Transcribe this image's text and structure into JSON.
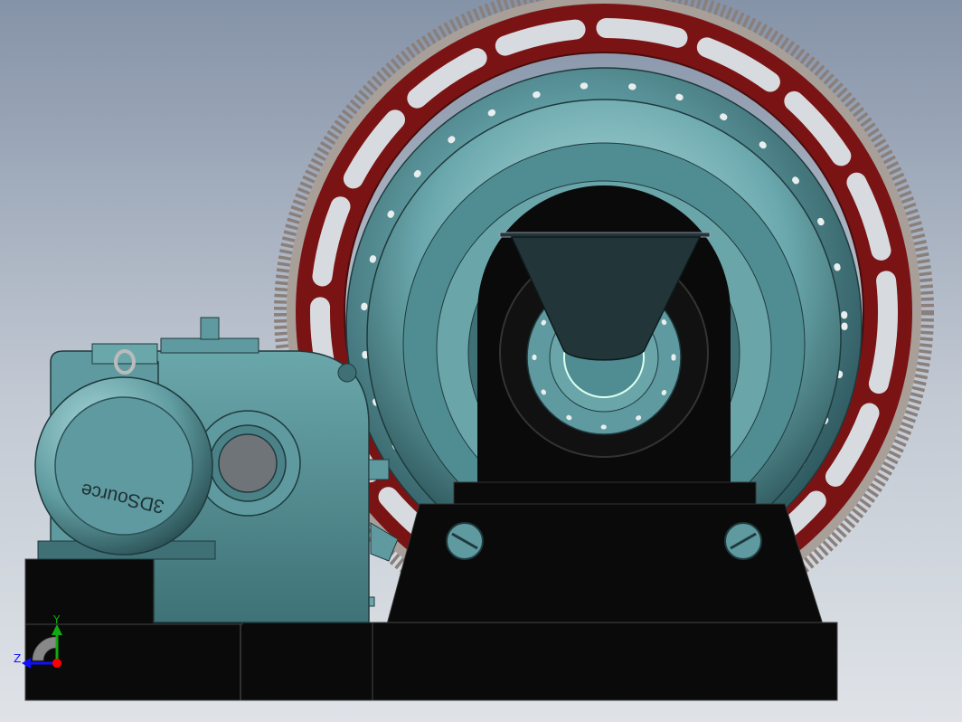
{
  "viewport": {
    "motor_badge_text": "3DSource",
    "triad": {
      "x_label": "",
      "y_label": "Y",
      "z_label": "Z"
    }
  },
  "colors": {
    "background_top": "#8593a8",
    "background_bottom": "#dfe3e8",
    "gear_teeth": "#8a7f7a",
    "gear_web": "#7a1414",
    "mill_body": "#5e9aa0",
    "mill_highlight": "#9fd0d4",
    "base_black": "#0a0a0a",
    "hopper": "#22363a",
    "triad_x": "#ff0000",
    "triad_y": "#11aa11",
    "triad_z": "#1010ff"
  }
}
